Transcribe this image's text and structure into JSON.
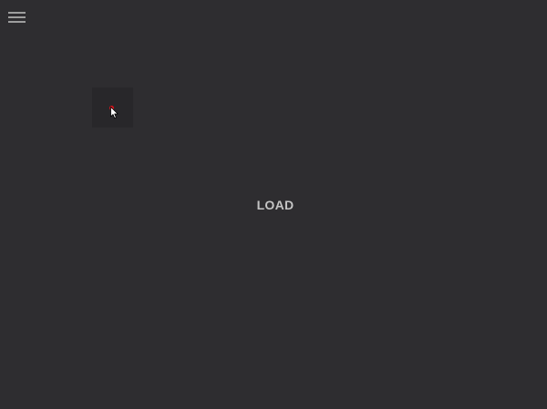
{
  "menu": {
    "icon": "hamburger-menu-icon"
  },
  "main": {
    "load_label": "LOAD"
  },
  "indicator": {
    "icon": "red-dot-icon",
    "color": "#d0141b"
  },
  "pointer": {
    "icon": "mouse-cursor-icon"
  },
  "colors": {
    "background": "#2e2d30",
    "hover_square": "#28272a",
    "text": "#c4c4c4"
  }
}
